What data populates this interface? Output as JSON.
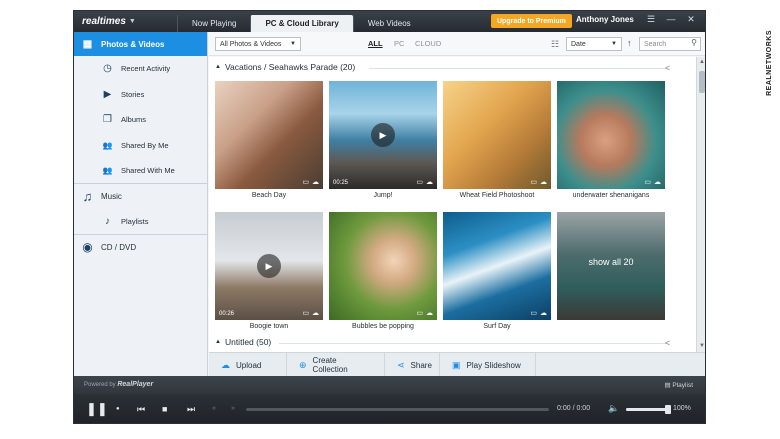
{
  "app": {
    "logo": "realtimes",
    "tabs": [
      "Now Playing",
      "PC & Cloud Library",
      "Web Videos"
    ],
    "active_tab": "PC & Cloud Library",
    "upgrade_label": "Upgrade to Premium",
    "user_name": "Anthony Jones",
    "window_controls": [
      "☰",
      "—",
      "✕"
    ],
    "accent": "#1d8fe3",
    "upgrade_color": "#f5a623"
  },
  "sidebar": {
    "items": [
      {
        "label": "Photos & Videos",
        "icon": "photos-icon",
        "glyph": "▦",
        "level": "top",
        "selected": true
      },
      {
        "label": "Recent Activity",
        "icon": "clock-icon",
        "glyph": "◷",
        "level": "sub"
      },
      {
        "label": "Stories",
        "icon": "stories-icon",
        "glyph": "▶",
        "level": "sub"
      },
      {
        "label": "Albums",
        "icon": "albums-icon",
        "glyph": "❐",
        "level": "sub"
      },
      {
        "label": "Shared By Me",
        "icon": "shared-by-me-icon",
        "glyph": "👥",
        "level": "sub"
      },
      {
        "label": "Shared With Me",
        "icon": "shared-with-me-icon",
        "glyph": "👥",
        "level": "sub"
      },
      {
        "label": "Music",
        "icon": "music-icon",
        "glyph": "♫",
        "level": "top"
      },
      {
        "label": "Playlists",
        "icon": "playlists-icon",
        "glyph": "♪",
        "level": "sub"
      },
      {
        "label": "CD / DVD",
        "icon": "disc-icon",
        "glyph": "◉",
        "level": "top"
      }
    ]
  },
  "filterbar": {
    "type_filter": "All Photos & Videos",
    "sources": [
      "ALL",
      "PC",
      "CLOUD"
    ],
    "active_source": "ALL",
    "sort_by": "Date",
    "sort_direction": "↑",
    "search_placeholder": "Search"
  },
  "sections": [
    {
      "title": "Vacations / Seahawks Parade (20)",
      "expanded": true
    },
    {
      "title": "Untitled (50)",
      "expanded": false
    }
  ],
  "thumbnails": [
    {
      "caption": "Beach Day",
      "video": false,
      "duration": ""
    },
    {
      "caption": "Jump!",
      "video": true,
      "duration": "00:25"
    },
    {
      "caption": "Wheat Field Photoshoot",
      "video": false,
      "duration": ""
    },
    {
      "caption": "underwater shenanigans",
      "video": false,
      "duration": ""
    },
    {
      "caption": "Boogie town",
      "video": true,
      "duration": "00:26"
    },
    {
      "caption": "Bubbles be popping",
      "video": false,
      "duration": ""
    },
    {
      "caption": "Surf Day",
      "video": false,
      "duration": ""
    },
    {
      "caption": "",
      "video": false,
      "duration": "",
      "overlay": "show all 20"
    }
  ],
  "actions": [
    {
      "label": "Upload",
      "icon": "upload-icon",
      "glyph": "☁"
    },
    {
      "label": "Create Collection",
      "icon": "add-icon",
      "glyph": "⊕"
    },
    {
      "label": "Share",
      "icon": "share-icon",
      "glyph": "⋖"
    },
    {
      "label": "Play Slideshow",
      "icon": "slideshow-icon",
      "glyph": "▣"
    }
  ],
  "statusbar": {
    "powered_by": "Powered by",
    "player_brand": "RealPlayer",
    "playlist_label": "Playlist"
  },
  "transport": {
    "time": "0:00 / 0:00",
    "volume_label": "100%",
    "volume_level": 1.0
  },
  "watermark": "REALNETWORKS"
}
